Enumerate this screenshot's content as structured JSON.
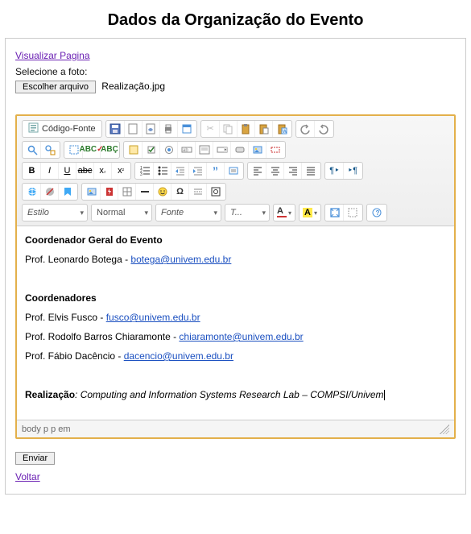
{
  "page": {
    "title": "Dados da Organização do Evento"
  },
  "links": {
    "preview": "Visualizar Pagina",
    "back": "Voltar"
  },
  "upload": {
    "label": "Selecione a foto:",
    "choose_button": "Escolher arquivo",
    "filename": "Realização.jpg"
  },
  "editor": {
    "source_label": "Código-Fonte",
    "style_select": "Estilo",
    "format_select": "Normal",
    "font_select": "Fonte",
    "size_select": "T...",
    "path": "body  p  p  em"
  },
  "content": {
    "h1": "Coordenador Geral do Evento",
    "coord_geral_name": "Prof. Leonardo Botega - ",
    "coord_geral_email": "botega@univem.edu.br",
    "h2": "Coordenadores",
    "c1_name": "Prof. Elvis Fusco - ",
    "c1_email": "fusco@univem.edu.br",
    "c2_name": "Prof. Rodolfo Barros Chiaramonte - ",
    "c2_email": "chiaramonte@univem.edu.br",
    "c3_name": "Prof. Fábio Dacêncio - ",
    "c3_email": "dacencio@univem.edu.br",
    "realizacao_label": "Realização",
    "realizacao_text": ": Computing and Information Systems Research Lab – COMPSI/Univem"
  },
  "actions": {
    "submit": "Enviar"
  }
}
